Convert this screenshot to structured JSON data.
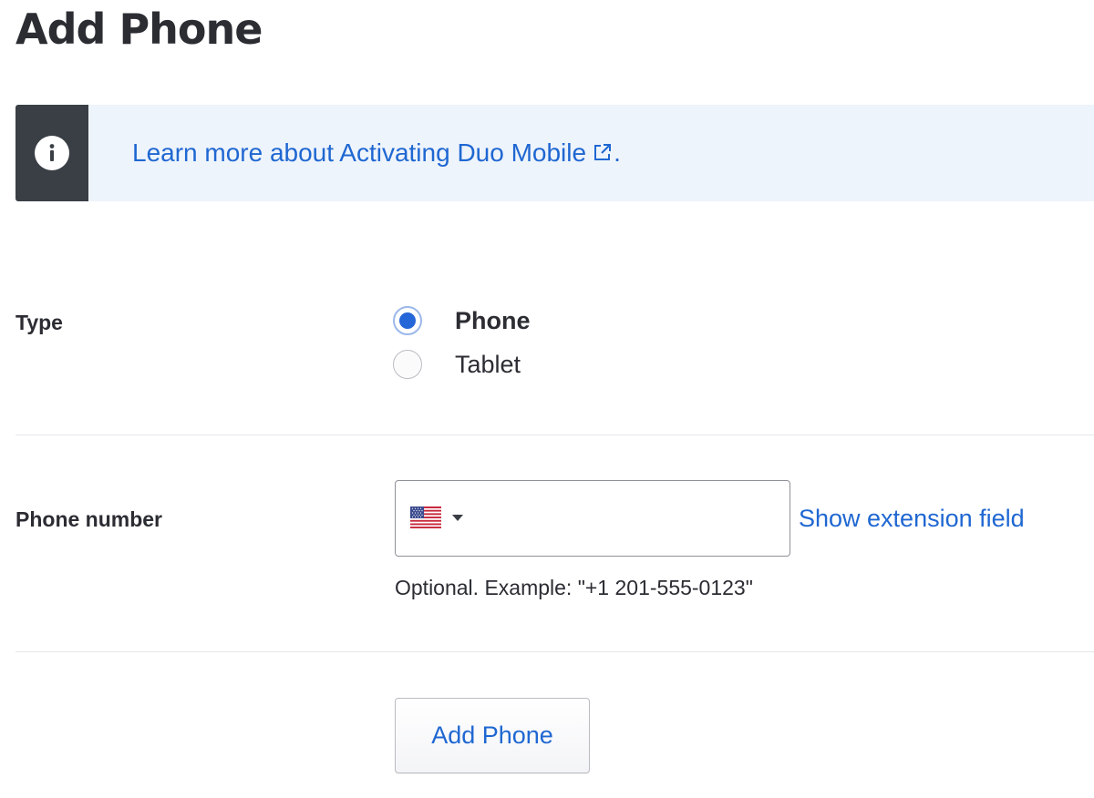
{
  "page": {
    "title": "Add Phone"
  },
  "info_banner": {
    "link_text": "Learn more about Activating Duo Mobile",
    "trailing_text": ".",
    "icon": "info-icon",
    "link_icon": "external-link-icon"
  },
  "form": {
    "type": {
      "label": "Type",
      "options": [
        {
          "label": "Phone",
          "selected": true
        },
        {
          "label": "Tablet",
          "selected": false
        }
      ]
    },
    "phone_number": {
      "label": "Phone number",
      "value": "",
      "country_flag": "us-flag-icon",
      "extension_link": "Show extension field",
      "hint": "Optional. Example: \"+1 201-555-0123\""
    },
    "submit_label": "Add Phone"
  },
  "colors": {
    "link": "#1f67d2",
    "banner_background": "#eef4fb",
    "banner_strip": "#3a3f46",
    "radio_selected": "#2566d8",
    "text": "#2b2d33"
  }
}
